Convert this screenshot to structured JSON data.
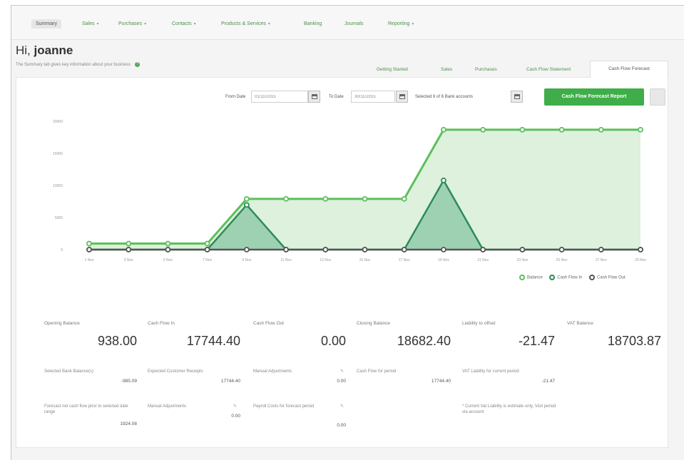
{
  "nav": {
    "tabs": [
      {
        "label": "Summary",
        "has_menu": false
      },
      {
        "label": "Sales",
        "has_menu": true
      },
      {
        "label": "Purchases",
        "has_menu": true
      },
      {
        "label": "Contacts",
        "has_menu": true
      },
      {
        "label": "Products & Services",
        "has_menu": true
      },
      {
        "label": "Banking",
        "has_menu": false
      },
      {
        "label": "Journals",
        "has_menu": false
      },
      {
        "label": "Reporting",
        "has_menu": true
      }
    ]
  },
  "header": {
    "greeting_prefix": "Hi,",
    "username": "joanne",
    "subtitle": "The Summary tab gives key information about your business"
  },
  "content_tabs": [
    "Getting Started",
    "Sales",
    "Purchases",
    "Cash Flow Statement",
    "Cash Flow Forecast"
  ],
  "filters": {
    "from_label": "From Date",
    "from_value": "01/11/2015",
    "to_label": "To Date",
    "to_value": "30/11/2015",
    "accounts_text": "Selected 6 of 6 Bank accounts",
    "export_label": "Cash Flow Forecast Report"
  },
  "chart_data": {
    "type": "line",
    "x": [
      "1 Nov",
      "3 Nov",
      "5 Nov",
      "7 Nov",
      "9 Nov",
      "11 Nov",
      "13 Nov",
      "15 Nov",
      "17 Nov",
      "19 Nov",
      "21 Nov",
      "23 Nov",
      "25 Nov",
      "27 Nov",
      "29 Nov"
    ],
    "yticks": [
      "20000",
      "15000",
      "10000",
      "5000",
      "0"
    ],
    "ylim": [
      0,
      20000
    ],
    "series": [
      {
        "name": "Balance",
        "color": "#5cbf5c",
        "values": [
          938,
          938,
          938,
          938,
          7900,
          7900,
          7900,
          7900,
          7900,
          18682.4,
          18682.4,
          18682.4,
          18682.4,
          18682.4,
          18682.4
        ]
      },
      {
        "name": "Cash Flow In",
        "color": "#2e8b57",
        "values": [
          0,
          0,
          0,
          0,
          6962,
          0,
          0,
          0,
          0,
          10782.4,
          0,
          0,
          0,
          0,
          0
        ]
      },
      {
        "name": "Cash Flow Out",
        "color": "#555555",
        "values": [
          0,
          0,
          0,
          0,
          0,
          0,
          0,
          0,
          0,
          0,
          0,
          0,
          0,
          0,
          0
        ]
      }
    ],
    "legend_position": "bottom-right",
    "grid": false
  },
  "summary": [
    {
      "label": "Opening Balance",
      "value": "938.00"
    },
    {
      "label": "Cash Flow In",
      "value": "17744.40"
    },
    {
      "label": "Cash Flow Out",
      "value": "0.00"
    },
    {
      "label": "Closing Balance",
      "value": "18682.40"
    },
    {
      "label": "Liability to offset",
      "value": "-21.47"
    },
    {
      "label": "VAT Balance",
      "value": "18703.87"
    }
  ],
  "details": {
    "selected_bank_label": "Selected Bank Balance(s)",
    "selected_bank_value": "-985.09",
    "forecast_label": "Forecast net cash flow prior to selected date range",
    "forecast_value": "1924.08",
    "expected_customer_label": "Expected Customer Receipts",
    "expected_customer_value": "17744.40",
    "manual_in_label": "Manual Adjustments",
    "manual_in_value": "0.00",
    "manual_out_label": "Manual Adjustments",
    "manual_out_value": "0.00",
    "payroll_label": "Payroll Costs for forecast period",
    "payroll_value": "0.00",
    "cash_flow_period_label": "Cash Flow for period",
    "cash_flow_period_value": "17744.40",
    "vat_liability_label": "VAT Liability for current period",
    "vat_liability_value": "-21.47",
    "vat_note": "* Current Vat Liability is estimate only, Visit period via account"
  }
}
